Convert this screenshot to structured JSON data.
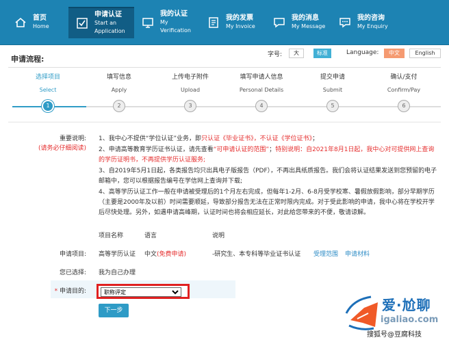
{
  "nav": [
    {
      "cn": "首页",
      "en": "Home",
      "icon": "home-icon"
    },
    {
      "cn": "申请认证",
      "en": "Start an Application",
      "icon": "checkbox-icon"
    },
    {
      "cn": "我的认证",
      "en": "My Verification",
      "icon": "monitor-icon"
    },
    {
      "cn": "我的发票",
      "en": "My Invoice",
      "icon": "invoice-icon"
    },
    {
      "cn": "我的消息",
      "en": "My Message",
      "icon": "message-icon"
    },
    {
      "cn": "我的咨询",
      "en": "My Enquiry",
      "icon": "enquiry-icon"
    }
  ],
  "header": {
    "title": "申请流程:",
    "font_label": "字号:",
    "font_large": "大",
    "font_standard": "标准",
    "lang_label": "Language:",
    "lang_cn": "中文",
    "lang_en": "English"
  },
  "steps": [
    {
      "cn": "选择项目",
      "en": "Select",
      "num": "1"
    },
    {
      "cn": "填写信息",
      "en": "Apply",
      "num": "2"
    },
    {
      "cn": "上传电子附件",
      "en": "Upload",
      "num": "3"
    },
    {
      "cn": "填写申请人信息",
      "en": "Personal Details",
      "num": "4"
    },
    {
      "cn": "提交申请",
      "en": "Submit",
      "num": "5"
    },
    {
      "cn": "确认/支付",
      "en": "Confirm/Pay",
      "num": "6"
    }
  ],
  "notice": {
    "label": "重要说明:",
    "label_note": "(请务必仔细阅读)",
    "n1_a": "1、我中心不提供“学位认证”业务，即",
    "n1_b": "只认证《毕业证书》，不认证《学位证书》",
    "n1_c": "；",
    "n2_a": "2、申请高等教育学历证书认证，请先查看",
    "n2_b": "“可申请认证的范围”",
    "n2_c": "；",
    "n2_d": "特别说明：自2021年8月1日起，我中心对可提供网上查询的学历证明书，不再提供学历认证服务;",
    "n3": "3、自2019年5月1日起，各类报告均只出具电子版报告（PDF），不再出具纸质报告。我们会将认证结果发送到您预留的电子邮箱中，您可以根据报告编号在学信网上查询并下载;",
    "n4": "4、高等学历认证工作一般在申请被受理后的1个月左右完成，但每年1-2月、6-8月受学校寒、暑假放假影响，部分早期学历（主要是2000年及以前）时间需要顺延，导致部分报告无法在正常时限内完成。对于受此影响的申请，我中心将在学校开学后尽快处理。另外，如遇申请高峰期，认证时间也将会相应延长，对此给您带来的不便，敬请谅解。"
  },
  "table": {
    "h_name": "项目名称",
    "h_lang": "语言",
    "h_desc": "说明",
    "apply_label": "申请项目:",
    "item_name": "高等学历认证",
    "item_lang": "中文",
    "item_free": "(免费申请)",
    "item_desc": "-研究生、本专科等毕业证书认证",
    "link_scope": "受理范围",
    "link_material": "申请材料",
    "choice_label": "您已选择:",
    "choice_value": "我为自己办理",
    "purpose_star": "*",
    "purpose_label": "申请目的:",
    "purpose_value": "职称评定",
    "next": "下一步"
  },
  "watermark": {
    "brand": "爱·尬聊",
    "url": "igaliao.com",
    "byline": "搜狐号@豆腐科技"
  },
  "colors": {
    "nav_bg": "#1d83b3",
    "accent": "#2e9bc6",
    "red": "#e52d2d",
    "highlight": "#e02020"
  }
}
